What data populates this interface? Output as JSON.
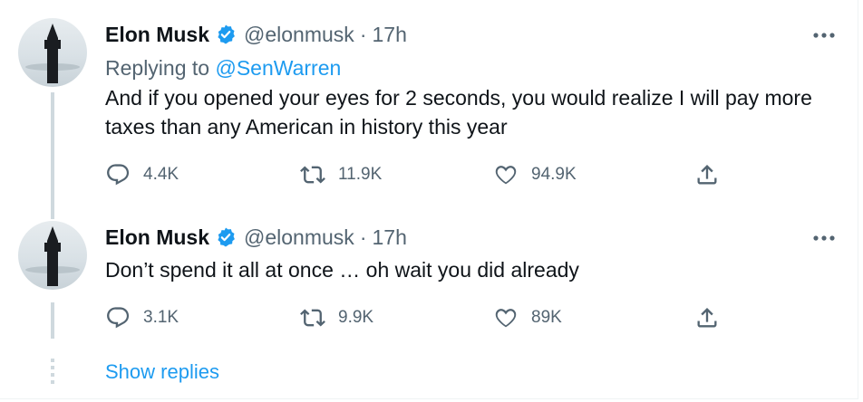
{
  "tweets": [
    {
      "name": "Elon Musk",
      "handle": "@elonmusk",
      "separator": "·",
      "time": "17h",
      "replying_prefix": "Replying to ",
      "replying_handle": "@SenWarren",
      "text": "And if you opened your eyes for 2 seconds, you would realize I will pay more taxes than any American in history this year",
      "replies": "4.4K",
      "retweets": "11.9K",
      "likes": "94.9K"
    },
    {
      "name": "Elon Musk",
      "handle": "@elonmusk",
      "separator": "·",
      "time": "17h",
      "text": "Don’t spend it all at once … oh wait you did already",
      "replies": "3.1K",
      "retweets": "9.9K",
      "likes": "89K"
    }
  ],
  "show_replies": "Show replies",
  "colors": {
    "accent": "#1d9bf0",
    "secondary_text": "#536471",
    "primary_text": "#0f1419",
    "thread_line": "#cfd9de"
  },
  "icons": [
    "verified-badge-icon",
    "more-options-icon",
    "reply-icon",
    "retweet-icon",
    "like-icon",
    "share-icon"
  ]
}
